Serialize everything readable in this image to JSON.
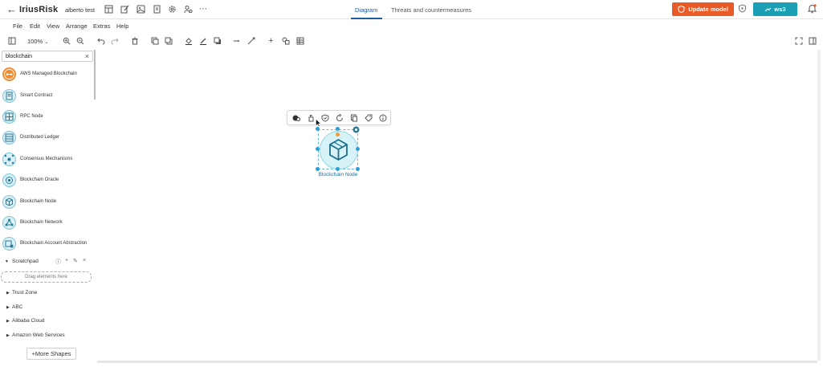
{
  "header": {
    "logo": "IriusRisk",
    "project_name": "alberto test",
    "tabs": [
      {
        "label": "Diagram",
        "active": true
      },
      {
        "label": "Threats and countermeasures",
        "active": false
      }
    ],
    "update_button": "Update model",
    "workspace_button": "ws3",
    "colors": {
      "update": "#e85a26",
      "workspace": "#1a9fb5",
      "active_tab": "#1b5c9e"
    }
  },
  "menu": {
    "items": [
      "File",
      "Edit",
      "View",
      "Arrange",
      "Extras",
      "Help"
    ]
  },
  "toolbar": {
    "zoom": "100%"
  },
  "sidebar": {
    "search_value": "blockchain",
    "shapes": [
      {
        "label": "AWS Managed Blockchain",
        "icon": "aws-blockchain-icon"
      },
      {
        "label": "Smart Contract",
        "icon": "smart-contract-icon"
      },
      {
        "label": "RPC Node",
        "icon": "rpc-node-icon"
      },
      {
        "label": "Distributed Ledger",
        "icon": "ledger-icon"
      },
      {
        "label": "Consensus Mechanisms",
        "icon": "consensus-icon"
      },
      {
        "label": "Blockchain Oracle",
        "icon": "oracle-icon"
      },
      {
        "label": "Blockchain Node",
        "icon": "cube-icon"
      },
      {
        "label": "Blockchain Network",
        "icon": "network-icon"
      },
      {
        "label": "Blockchain Account Abstraction",
        "icon": "account-icon"
      }
    ],
    "scratchpad": {
      "title": "Scratchpad",
      "drop_text": "Drag elements here"
    },
    "libraries": [
      "Trust Zone",
      "ABC",
      "Alibaba Cloud",
      "Amazon Web Services"
    ],
    "more_shapes": "+More Shapes"
  },
  "canvas": {
    "selected_node_label": "Blockchain Node"
  }
}
